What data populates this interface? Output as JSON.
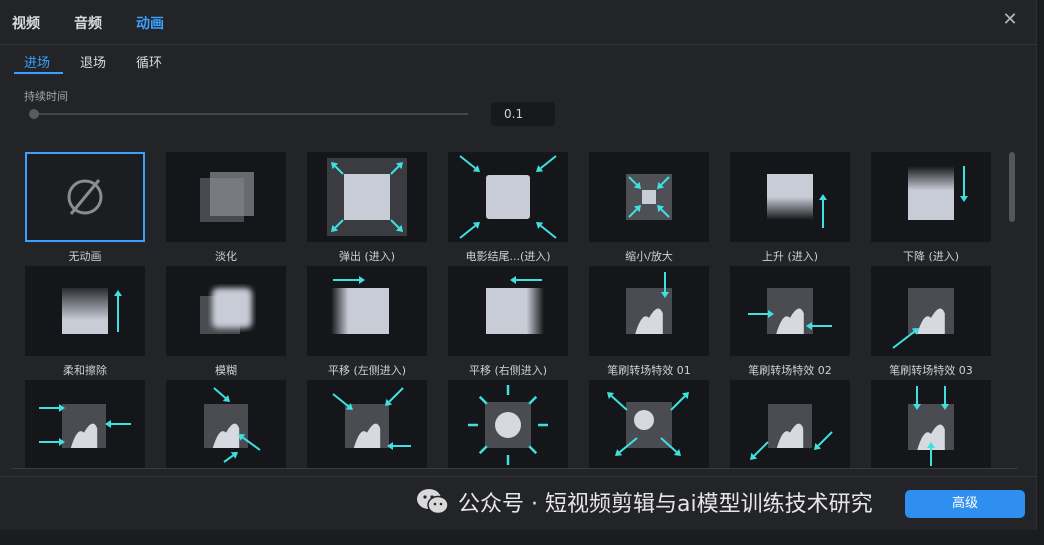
{
  "top_tabs": [
    {
      "label": "视频"
    },
    {
      "label": "音频"
    },
    {
      "label": "动画",
      "active": true
    }
  ],
  "sub_tabs": [
    {
      "label": "进场",
      "active": true
    },
    {
      "label": "退场"
    },
    {
      "label": "循环"
    }
  ],
  "duration": {
    "label": "持续时间",
    "value": "0.1",
    "slider_fraction": 0.0
  },
  "animations": [
    {
      "name": "无动画",
      "icon": "none-icon",
      "selected": true
    },
    {
      "name": "淡化",
      "icon": "fade-icon"
    },
    {
      "name": "弹出 (进入)",
      "icon": "pop-out-icon"
    },
    {
      "name": "电影结尾...(进入)",
      "icon": "movie-end-icon"
    },
    {
      "name": "缩小/放大",
      "icon": "zoom-icon"
    },
    {
      "name": "上升 (进入)",
      "icon": "rise-icon"
    },
    {
      "name": "下降 (进入)",
      "icon": "fall-icon"
    },
    {
      "name": "柔和擦除",
      "icon": "soft-wipe-icon"
    },
    {
      "name": "模糊",
      "icon": "blur-icon"
    },
    {
      "name": "平移 (左侧进入)",
      "icon": "slide-left-icon"
    },
    {
      "name": "平移 (右侧进入)",
      "icon": "slide-right-icon"
    },
    {
      "name": "笔刷转场特效 01",
      "icon": "brush-01-icon"
    },
    {
      "name": "笔刷转场特效 02",
      "icon": "brush-02-icon"
    },
    {
      "name": "笔刷转场特效 03",
      "icon": "brush-03-icon"
    },
    {
      "name": "",
      "icon": "brush-horizontal-icon"
    },
    {
      "name": "",
      "icon": "brush-diagonal-icon"
    },
    {
      "name": "",
      "icon": "brush-corner-icon"
    },
    {
      "name": "",
      "icon": "burst-icon"
    },
    {
      "name": "",
      "icon": "brush-radial-icon"
    },
    {
      "name": "",
      "icon": "brush-diag2-icon"
    },
    {
      "name": "",
      "icon": "brush-vertical-icon"
    }
  ],
  "advanced_button": "高级",
  "watermark": "公众号 · 短视频剪辑与ai模型训练技术研究",
  "colors": {
    "accent": "#3aa0ff",
    "arrow": "#3fe0e0"
  }
}
